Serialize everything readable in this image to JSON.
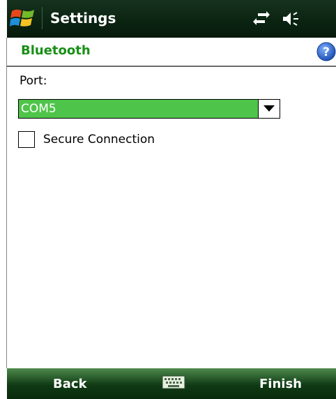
{
  "titlebar": {
    "title": "Settings",
    "icons": [
      "windows-logo-icon",
      "sync-icon",
      "volume-muted-icon"
    ]
  },
  "header": {
    "title": "Bluetooth",
    "help_icon": "help-icon"
  },
  "form": {
    "port_label": "Port:",
    "port_value": "COM5",
    "secure_connection_label": "Secure Connection",
    "secure_connection_checked": false
  },
  "softkeys": {
    "left": "Back",
    "right": "Finish",
    "center_icon": "keyboard-icon"
  },
  "colors": {
    "accent_green": "#189016",
    "select_highlight": "#4fc44a",
    "titlebar_dark": "#0b2412"
  }
}
